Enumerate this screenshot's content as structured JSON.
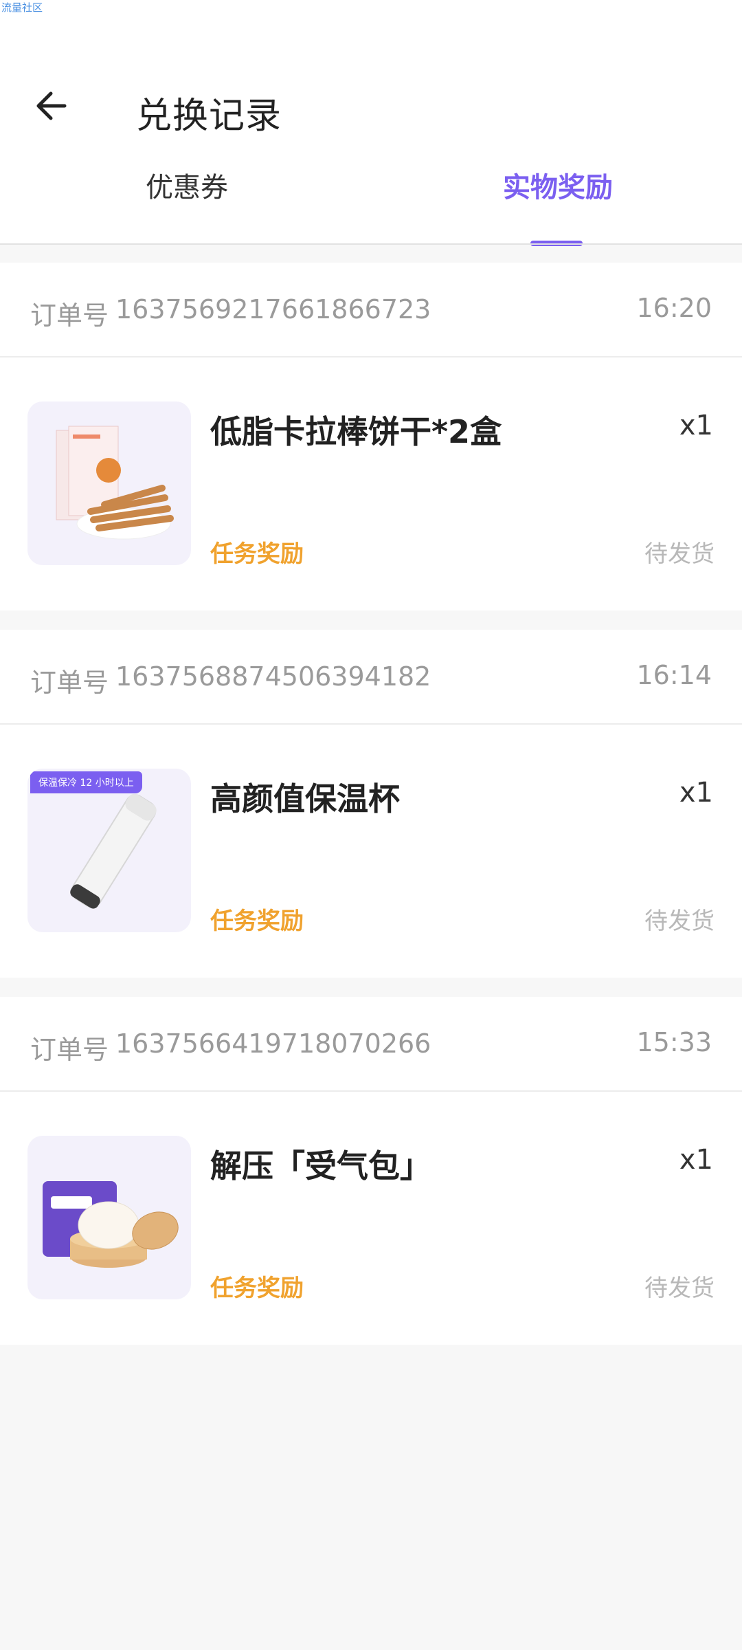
{
  "watermark": "流量社区",
  "header": {
    "title": "兑换记录"
  },
  "tabs": [
    {
      "label": "优惠券",
      "active": false
    },
    {
      "label": "实物奖励",
      "active": true
    }
  ],
  "colors": {
    "accent": "#7b5ff0",
    "reward": "#f0a22e",
    "muted": "#9a9a9a"
  },
  "orders": [
    {
      "order_label": "订单号",
      "order_no": "1637569217661866723",
      "time": "16:20",
      "item_name": "低脂卡拉棒饼干*2盒",
      "qty": "x1",
      "reward_type": "任务奖励",
      "status": "待发货"
    },
    {
      "order_label": "订单号",
      "order_no": "1637568874506394182",
      "time": "16:14",
      "item_name": "高颜值保温杯",
      "qty": "x1",
      "reward_type": "任务奖励",
      "status": "待发货",
      "badge": "保温保冷 12 小时以上"
    },
    {
      "order_label": "订单号",
      "order_no": "1637566419718070266",
      "time": "15:33",
      "item_name": "解压「受气包」",
      "qty": "x1",
      "reward_type": "任务奖励",
      "status": "待发货"
    }
  ]
}
